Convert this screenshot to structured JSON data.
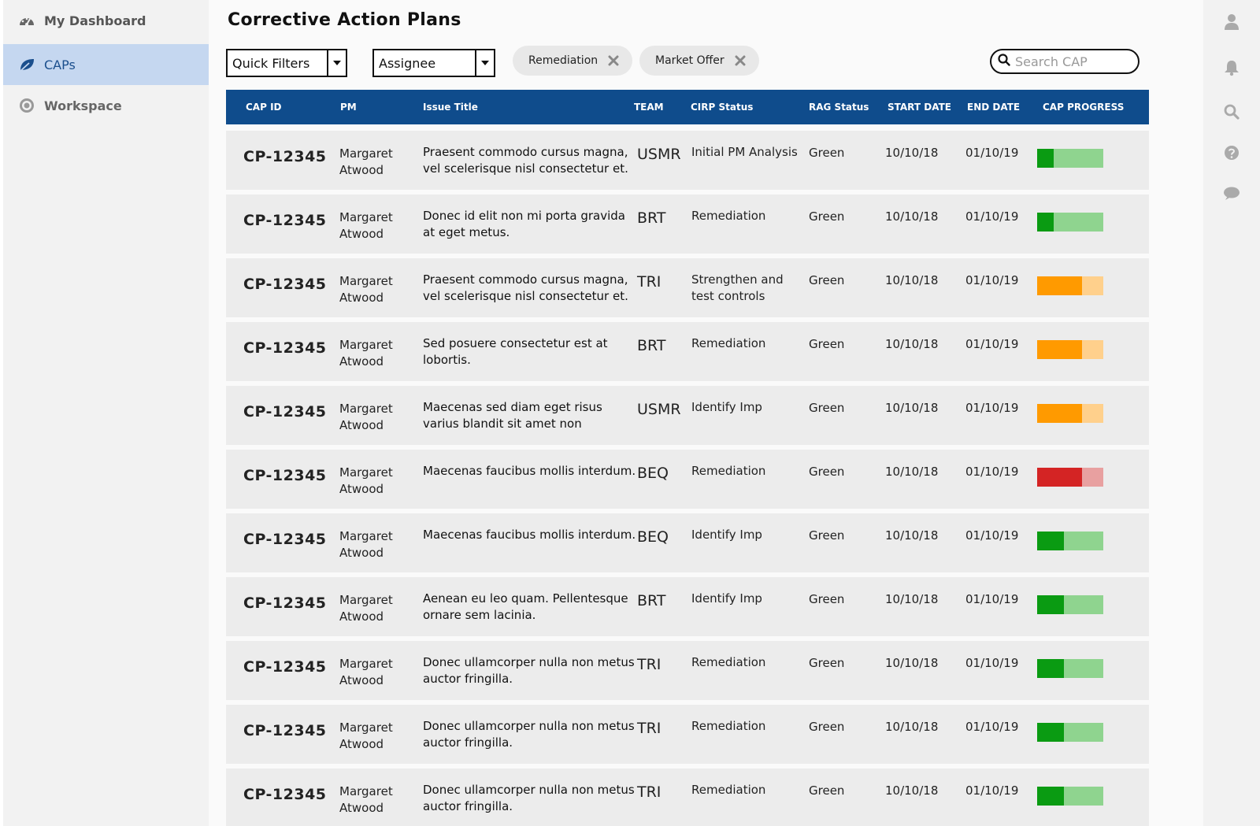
{
  "sidebar": {
    "items": [
      {
        "label": "My Dashboard",
        "icon": "dashboard-icon",
        "active": false
      },
      {
        "label": "CAPs",
        "icon": "leaf-icon",
        "active": true
      },
      {
        "label": "Workspace",
        "icon": "target-icon",
        "active": false
      }
    ]
  },
  "header": {
    "title": "Corrective Action Plans"
  },
  "filters": {
    "quick_filters": "Quick Filters",
    "assignee": "Assignee",
    "chips": [
      "Remediation",
      "Market Offer"
    ],
    "search_placeholder": "Search CAP"
  },
  "table": {
    "columns": [
      "CAP ID",
      "PM",
      "Issue Title",
      "TEAM",
      "CIRP Status",
      "RAG Status",
      "START DATE",
      "END DATE",
      "CAP PROGRESS"
    ],
    "rows": [
      {
        "id": "CP-12345",
        "pm": "Margaret Atwood",
        "issue": "Praesent commodo cursus magna, vel scelerisque nisl consectetur et.",
        "team": "USMR",
        "cirp": "Initial PM Analysis",
        "rag": "Green",
        "start": "10/10/18",
        "end": "01/10/19",
        "progress": 0.25,
        "color": "green"
      },
      {
        "id": "CP-12345",
        "pm": "Margaret Atwood",
        "issue": "Donec id elit non mi porta gravida at eget metus.",
        "team": "BRT",
        "cirp": "Remediation",
        "rag": "Green",
        "start": "10/10/18",
        "end": "01/10/19",
        "progress": 0.25,
        "color": "green"
      },
      {
        "id": "CP-12345",
        "pm": "Margaret Atwood",
        "issue": "Praesent commodo cursus magna, vel scelerisque nisl consectetur et.",
        "team": "TRI",
        "cirp": "Strengthen and test controls",
        "rag": "Green",
        "start": "10/10/18",
        "end": "01/10/19",
        "progress": 0.68,
        "color": "orange"
      },
      {
        "id": "CP-12345",
        "pm": "Margaret Atwood",
        "issue": "Sed posuere consectetur est at lobortis.",
        "team": "BRT",
        "cirp": "Remediation",
        "rag": "Green",
        "start": "10/10/18",
        "end": "01/10/19",
        "progress": 0.68,
        "color": "orange"
      },
      {
        "id": "CP-12345",
        "pm": "Margaret Atwood",
        "issue": "Maecenas sed diam eget risus varius blandit sit amet non",
        "team": "USMR",
        "cirp": "Identify Imp",
        "rag": "Green",
        "start": "10/10/18",
        "end": "01/10/19",
        "progress": 0.68,
        "color": "orange"
      },
      {
        "id": "CP-12345",
        "pm": "Margaret Atwood",
        "issue": "Maecenas faucibus mollis interdum.",
        "team": "BEQ",
        "cirp": "Remediation",
        "rag": "Green",
        "start": "10/10/18",
        "end": "01/10/19",
        "progress": 0.68,
        "color": "red"
      },
      {
        "id": "CP-12345",
        "pm": "Margaret Atwood",
        "issue": "Maecenas faucibus mollis interdum.",
        "team": "BEQ",
        "cirp": "Identify Imp",
        "rag": "Green",
        "start": "10/10/18",
        "end": "01/10/19",
        "progress": 0.4,
        "color": "green"
      },
      {
        "id": "CP-12345",
        "pm": "Margaret Atwood",
        "issue": "Aenean eu leo quam. Pellentesque ornare sem lacinia.",
        "team": "BRT",
        "cirp": "Identify Imp",
        "rag": "Green",
        "start": "10/10/18",
        "end": "01/10/19",
        "progress": 0.4,
        "color": "green"
      },
      {
        "id": "CP-12345",
        "pm": "Margaret Atwood",
        "issue": "Donec ullamcorper nulla non metus auctor fringilla.",
        "team": "TRI",
        "cirp": "Remediation",
        "rag": "Green",
        "start": "10/10/18",
        "end": "01/10/19",
        "progress": 0.4,
        "color": "green"
      },
      {
        "id": "CP-12345",
        "pm": "Margaret Atwood",
        "issue": "Donec ullamcorper nulla non metus auctor fringilla.",
        "team": "TRI",
        "cirp": "Remediation",
        "rag": "Green",
        "start": "10/10/18",
        "end": "01/10/19",
        "progress": 0.4,
        "color": "green"
      },
      {
        "id": "CP-12345",
        "pm": "Margaret Atwood",
        "issue": "Donec ullamcorper nulla non metus auctor fringilla.",
        "team": "TRI",
        "cirp": "Remediation",
        "rag": "Green",
        "start": "10/10/18",
        "end": "01/10/19",
        "progress": 0.4,
        "color": "green"
      }
    ]
  },
  "progress_colors": {
    "green": {
      "fill": "#0a9b12",
      "track": "#8fd48f"
    },
    "orange": {
      "fill": "#ff9a00",
      "track": "#ffd08c"
    },
    "red": {
      "fill": "#d42424",
      "track": "#e8a0a0"
    }
  },
  "rail_icons": [
    "user-icon",
    "bell-icon",
    "search-icon",
    "help-icon",
    "chat-icon"
  ],
  "colors": {
    "header_bg": "#0f4c8c",
    "active_nav_bg": "#c5d7f0"
  }
}
